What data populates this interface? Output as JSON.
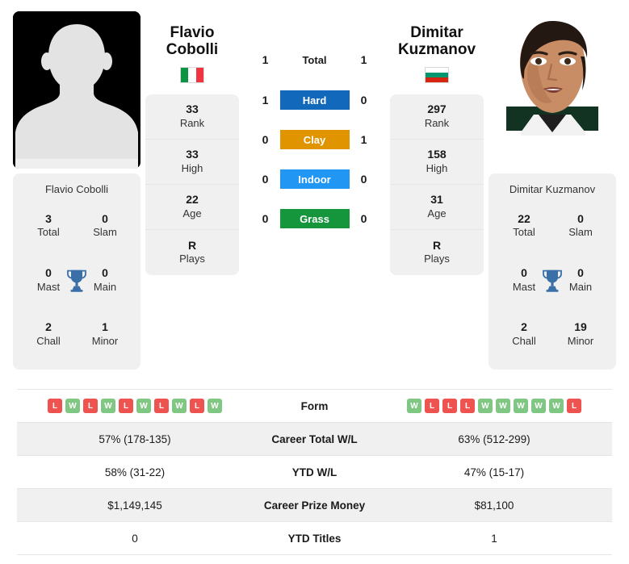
{
  "players": {
    "left": {
      "first_name": "Flavio",
      "last_name": "Cobolli",
      "full_name": "Flavio Cobolli",
      "country": "Italy",
      "flag": "italy-flag",
      "photo": "placeholder-silhouette-avatar",
      "stats": [
        {
          "value": "33",
          "label": "Rank"
        },
        {
          "value": "33",
          "label": "High"
        },
        {
          "value": "22",
          "label": "Age"
        },
        {
          "value": "R",
          "label": "Plays"
        }
      ],
      "titles": {
        "total": "3",
        "total_label": "Total",
        "slam": "0",
        "slam_label": "Slam",
        "mast": "0",
        "mast_label": "Mast",
        "main": "0",
        "main_label": "Main",
        "chall": "2",
        "chall_label": "Chall",
        "minor": "1",
        "minor_label": "Minor"
      },
      "form": [
        "L",
        "W",
        "L",
        "W",
        "L",
        "W",
        "L",
        "W",
        "L",
        "W"
      ],
      "career_total_wl": "57% (178-135)",
      "ytd_wl": "58% (31-22)",
      "career_prize_money": "$1,149,145",
      "ytd_titles": "0"
    },
    "right": {
      "first_name": "Dimitar",
      "last_name": "Kuzmanov",
      "full_name": "Dimitar Kuzmanov",
      "country": "Bulgaria",
      "flag": "bulgaria-flag",
      "photo": "player-headshot",
      "stats": [
        {
          "value": "297",
          "label": "Rank"
        },
        {
          "value": "158",
          "label": "High"
        },
        {
          "value": "31",
          "label": "Age"
        },
        {
          "value": "R",
          "label": "Plays"
        }
      ],
      "titles": {
        "total": "22",
        "total_label": "Total",
        "slam": "0",
        "slam_label": "Slam",
        "mast": "0",
        "mast_label": "Mast",
        "main": "0",
        "main_label": "Main",
        "chall": "2",
        "chall_label": "Chall",
        "minor": "19",
        "minor_label": "Minor"
      },
      "form": [
        "W",
        "L",
        "L",
        "L",
        "W",
        "W",
        "W",
        "W",
        "W",
        "L"
      ],
      "career_total_wl": "63% (512-299)",
      "ytd_wl": "47% (15-17)",
      "career_prize_money": "$81,100",
      "ytd_titles": "1"
    }
  },
  "head_to_head": [
    {
      "label": "Total",
      "left": "1",
      "right": "1",
      "type": "plain",
      "color": ""
    },
    {
      "label": "Hard",
      "left": "1",
      "right": "0",
      "type": "badge",
      "color": "#1268bb"
    },
    {
      "label": "Clay",
      "left": "0",
      "right": "1",
      "type": "badge",
      "color": "#e09400"
    },
    {
      "label": "Indoor",
      "left": "0",
      "right": "0",
      "type": "badge",
      "color": "#2196f3"
    },
    {
      "label": "Grass",
      "left": "0",
      "right": "0",
      "type": "badge",
      "color": "#16963c"
    }
  ],
  "table": {
    "rows": [
      {
        "label": "Form",
        "key": "form",
        "kind": "form"
      },
      {
        "label": "Career Total W/L",
        "key": "career_total_wl",
        "kind": "text"
      },
      {
        "label": "YTD W/L",
        "key": "ytd_wl",
        "kind": "text"
      },
      {
        "label": "Career Prize Money",
        "key": "career_prize_money",
        "kind": "text"
      },
      {
        "label": "YTD Titles",
        "key": "ytd_titles",
        "kind": "text"
      }
    ]
  },
  "colors": {
    "win_badge": "#81c784",
    "loss_badge": "#ef5350",
    "card_bg": "#f0f0f0",
    "trophy": "#3b6fa8",
    "hard": "#1268bb",
    "clay": "#e09400",
    "indoor": "#2196f3",
    "grass": "#16963c"
  },
  "icons": {
    "trophy": "trophy-icon"
  }
}
